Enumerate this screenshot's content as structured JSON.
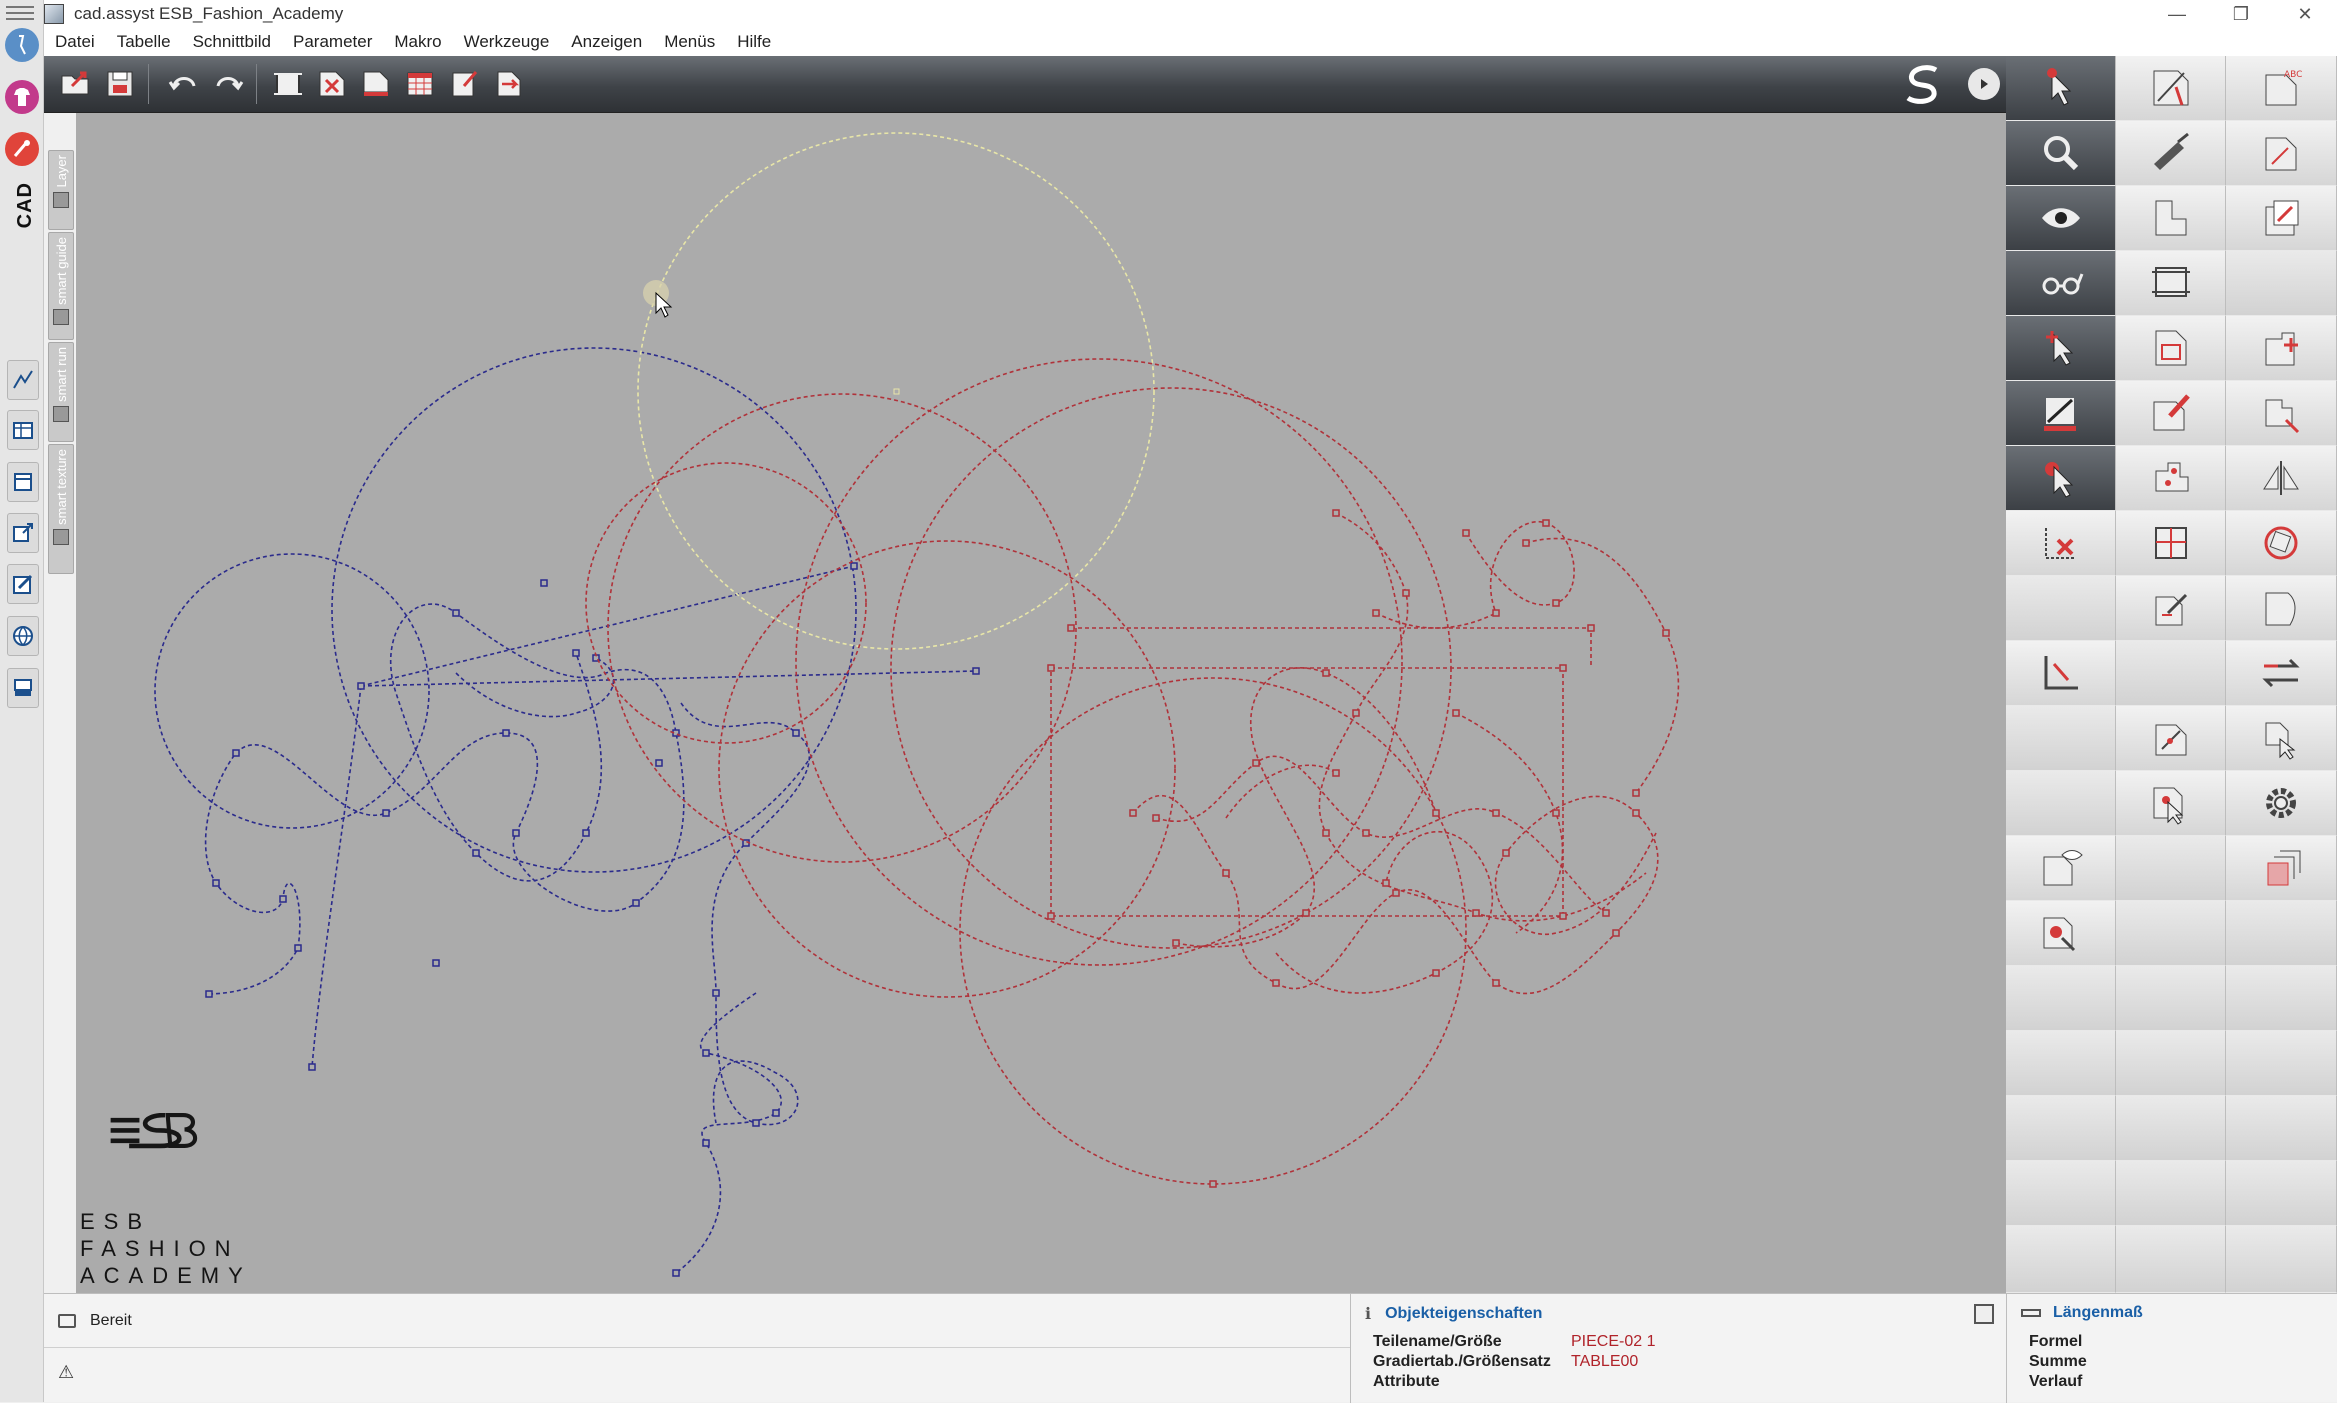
{
  "window": {
    "title": "cad.assyst  ESB_Fashion_Academy",
    "minimize": "—",
    "restore": "❐",
    "close": "✕"
  },
  "app_strip": {
    "cad_label": "CAD"
  },
  "menu": [
    "Datei",
    "Tabelle",
    "Schnittbild",
    "Parameter",
    "Makro",
    "Werkzeuge",
    "Anzeigen",
    "Menüs",
    "Hilfe"
  ],
  "side_tabs": [
    "Layer",
    "smart guide",
    "smart run",
    "smart texture"
  ],
  "toolbar": {
    "items": [
      "open-icon",
      "save-icon",
      "undo-icon",
      "redo-icon",
      "frame-icon",
      "delete-piece-icon",
      "print-icon",
      "table-icon",
      "clipboard-icon",
      "flag-icon"
    ]
  },
  "tool_panel": {
    "col1": [
      "select-arrow-icon",
      "zoom-icon",
      "view-eye-icon",
      "glasses-icon",
      "pointer-plus-icon",
      "edit-measure-icon",
      "pointer-circle-icon",
      "delete-points-icon",
      "",
      "corner-icon",
      "",
      "",
      "piece-eye-icon",
      "piece-search-icon",
      "",
      "",
      "",
      ""
    ],
    "col2": [
      "draw-line-icon",
      "brush-icon",
      "piece-icon",
      "plotter-icon",
      "piece-grid-icon",
      "piece-pencil-icon",
      "piece-network-icon",
      "piece-fold-icon",
      "piece-edit-icon",
      "",
      "piece-cut-icon",
      "piece-cursor-icon",
      "",
      "",
      "",
      "",
      "",
      ""
    ],
    "col3": [
      "piece-abc-icon",
      "piece-mark-icon",
      "piece-move-icon",
      "",
      "piece-add-icon",
      "piece-resize-icon",
      "mirror-icon",
      "rotate-piece-icon",
      "piece-shape-icon",
      "swap-arrows-icon",
      "piece-arrow-icon",
      "settings-gear-icon",
      "layered-pieces-icon",
      "",
      "",
      "",
      "",
      ""
    ]
  },
  "logo": {
    "line1": "ESB",
    "line2": "FASHION",
    "line3": "ACADEMY"
  },
  "status": {
    "ready": "Bereit",
    "warning_icon": "warning-icon"
  },
  "object_properties": {
    "title": "Objekteigenschaften",
    "rows": [
      {
        "label": "Teilename/Größe",
        "value": "PIECE-02 1"
      },
      {
        "label": "Gradiertab./Größensatz",
        "value": "TABLE00"
      },
      {
        "label": "Attribute",
        "value": ""
      }
    ]
  },
  "length_measure": {
    "title": "Längenmaß",
    "rows": [
      "Formel",
      "Summe",
      "Verlauf"
    ]
  },
  "colors": {
    "canvas": "#ababab",
    "blue_curves": "#2b2b8c",
    "red_curves": "#b0323a",
    "yellow_circle": "#e8e6a8",
    "toolbar_dark": "#3f4348"
  }
}
